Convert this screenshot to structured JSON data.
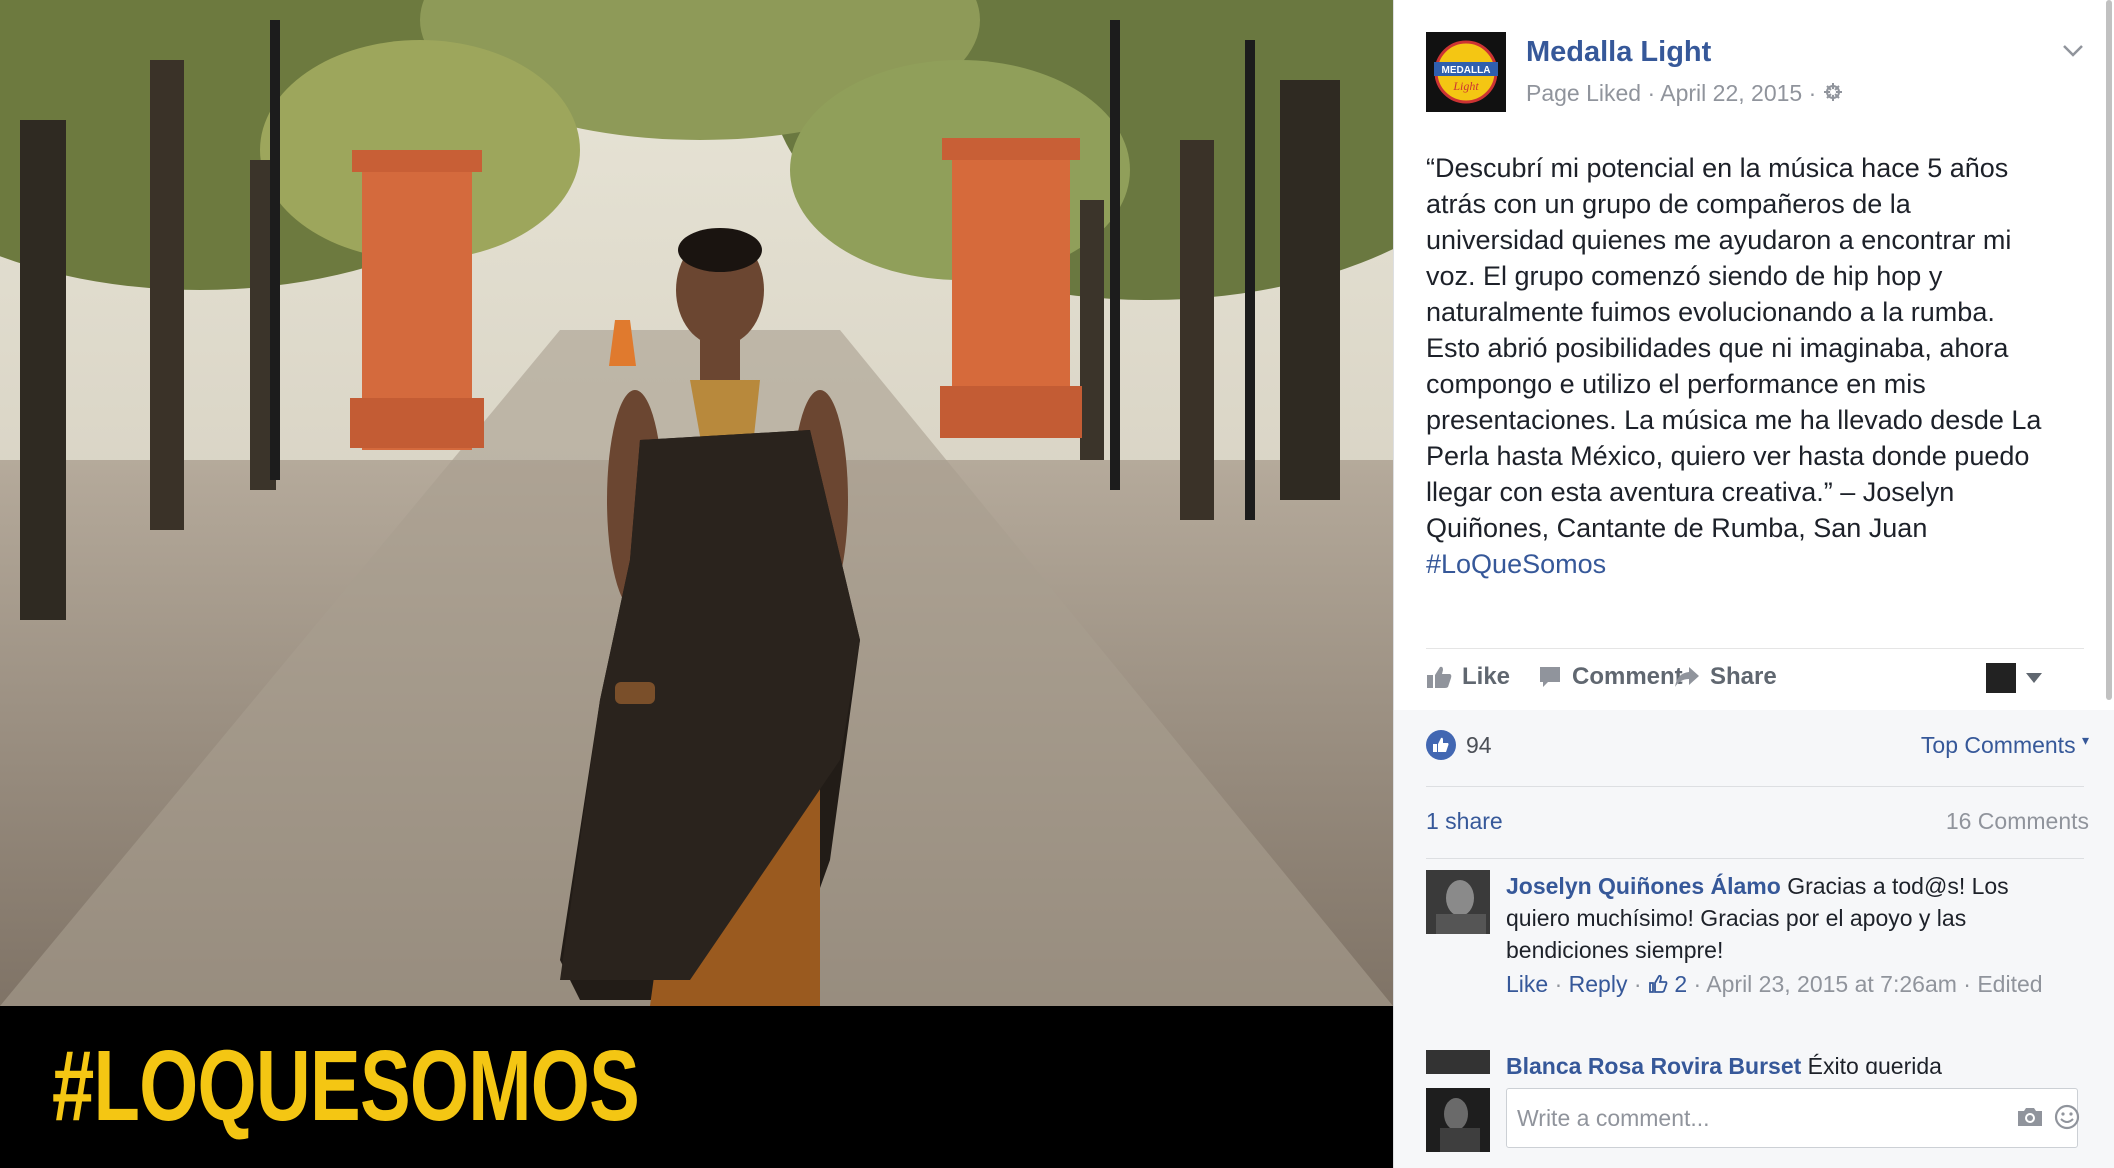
{
  "photo": {
    "hashtag_overlay": "#LOQUESOMOS",
    "accent": "#f4c613"
  },
  "post": {
    "page_name": "Medalla Light",
    "avatar_text": [
      "MEDALLA",
      "Light"
    ],
    "meta": "Page Liked · April 22, 2015 · ",
    "body_lines": [
      "“Descubrí mi potencial en la música hace 5 años",
      "atrás con un grupo de compañeros de la",
      "universidad quienes me ayudaron a encontrar mi",
      "voz. El grupo comenzó siendo de hip hop y",
      "naturalmente fuimos evolucionando a la rumba.",
      "Esto abrió posibilidades que ni imaginaba, ahora",
      "compongo e utilizo el performance en mis",
      "presentaciones. La música me ha llevado desde La",
      "Perla hasta México, quiero ver hasta donde puedo",
      "llegar con esta aventura creativa.” – Joselyn",
      "Quiñones, Cantante de Rumba, San Juan"
    ],
    "hashtag": "#LoQueSomos",
    "actions": {
      "like": "Like",
      "comment": "Comment",
      "share": "Share"
    }
  },
  "feedback": {
    "reaction_count": "94",
    "sort_label": "Top Comments",
    "shares": "1 share",
    "comment_count": "16 Comments"
  },
  "comments": [
    {
      "author": "Joselyn Quiñones Álamo",
      "text": "Gracias a tod@s! Los quiero muchísimo! Gracias por el apoyo y las bendiciones siempre!",
      "like": "Like",
      "reply": "Reply",
      "likes": "2",
      "date": "April 23, 2015 at 7:26am",
      "edited": "Edited"
    },
    {
      "author": "Blanca Rosa Rovira Burset",
      "text": "Éxito querida"
    }
  ],
  "composer": {
    "placeholder": "Write a comment..."
  }
}
